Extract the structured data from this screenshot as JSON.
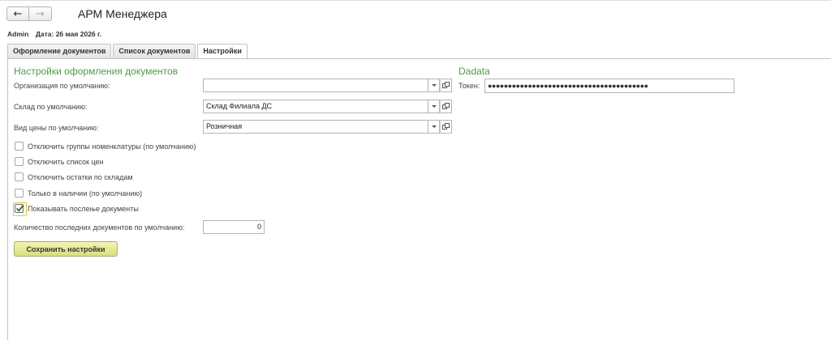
{
  "app": {
    "title": "АРМ Менеджера"
  },
  "nav": {
    "back_glyph": "🡐",
    "forward_glyph": "🡒"
  },
  "user": {
    "name": "Admin",
    "date": "Дата: 26 мая 2026 г."
  },
  "tabs": [
    {
      "label": "Оформление документов"
    },
    {
      "label": "Список документов"
    },
    {
      "label": "Настройки"
    }
  ],
  "settings": {
    "section_title": "Настройки оформления документов",
    "fields": {
      "org": {
        "label": "Организация по умолчанию:",
        "value": ""
      },
      "warehouse": {
        "label": "Склад по умолчанию:",
        "value": "Склад Филиала ДС"
      },
      "price": {
        "label": "Вид цены по умолчанию:",
        "value": "Розничная"
      }
    },
    "checkboxes": [
      {
        "label": "Отключить группы номенклатуры (по умолчанию)",
        "checked": false
      },
      {
        "label": "Отключить список цен",
        "checked": false
      },
      {
        "label": "Отключить остатки по складам",
        "checked": false
      },
      {
        "label": "Только в наличии (по умолчанию)",
        "checked": false
      },
      {
        "label": "Показывать послење документы",
        "checked": true
      }
    ],
    "recent_count": {
      "label": "Количество последних документов по умолчанию:",
      "value": "0"
    },
    "save_button": "Сохранить настройки"
  },
  "dadata": {
    "section_title": "Dadata",
    "token_label": "Токен:",
    "token_value": "●●●●●●●●●●●●●●●●●●●●●●●●●●●●●●●●●●●●●●●●"
  },
  "icons": {
    "dropdown": "chevron-down-icon",
    "open": "open-window-icon",
    "check": "check-icon"
  },
  "colors": {
    "section_green": "#4b9d45",
    "save_button": "#e3e78f"
  }
}
